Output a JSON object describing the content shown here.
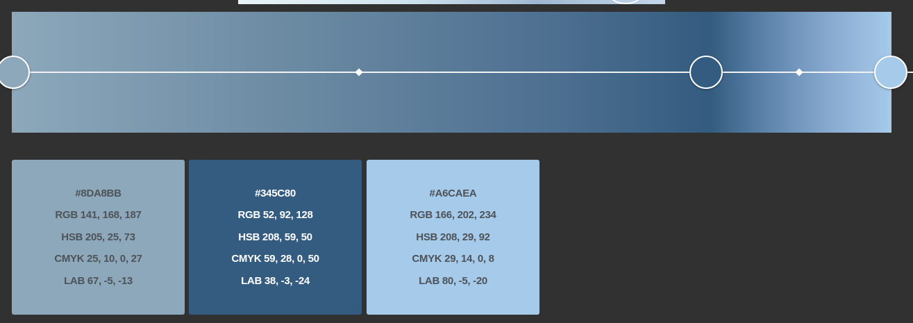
{
  "gradient": {
    "stops": [
      {
        "color": "#8DA8BB",
        "location_percent": 0
      },
      {
        "color": "#345C80",
        "location_percent": 79
      },
      {
        "color": "#A6CAEA",
        "location_percent": 100
      }
    ],
    "midpoints_percent": [
      40,
      90
    ]
  },
  "swatches": [
    {
      "color": "#8DA8BB",
      "hex": "#8DA8BB",
      "rgb": "RGB 141, 168, 187",
      "hsb": "HSB 205, 25, 73",
      "cmyk": "CMYK 25, 10, 0, 27",
      "lab": "LAB 67, -5, -13"
    },
    {
      "color": "#345C80",
      "hex": "#345C80",
      "rgb": "RGB 52, 92, 128",
      "hsb": "HSB 208, 59, 50",
      "cmyk": "CMYK 59, 28, 0, 50",
      "lab": "LAB 38, -3, -24"
    },
    {
      "color": "#A6CAEA",
      "hex": "#A6CAEA",
      "rgb": "RGB 166, 202, 234",
      "hsb": "HSB 208, 29, 92",
      "cmyk": "CMYK 29, 14, 0, 8",
      "lab": "LAB 80, -5, -20"
    }
  ]
}
